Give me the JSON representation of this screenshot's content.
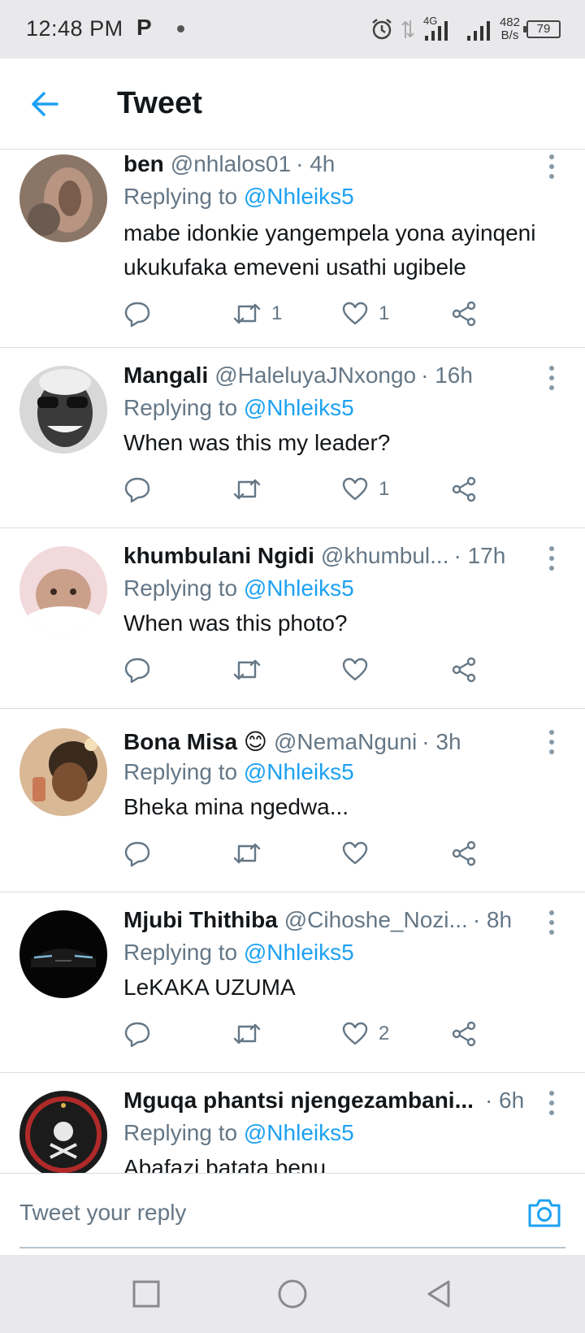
{
  "status_bar": {
    "time": "12:48 PM",
    "carrier_icon": "P",
    "network": "4G",
    "speed_value": "482",
    "speed_unit": "B/s",
    "battery": "79"
  },
  "header": {
    "title": "Tweet"
  },
  "reply_prefix": "Replying to",
  "tweets": [
    {
      "name": "ben",
      "handle": "@nhlalos01",
      "time": "· 4h",
      "replying_to": "@Nhleiks5",
      "text": "mabe idonkie yangempela yona ayinqeni ukukufaka emeveni usathi ugibele",
      "retweets": "1",
      "likes": "1"
    },
    {
      "name": "Mangali",
      "handle": "@HaleluyaJNxongo",
      "time": "· 16h",
      "replying_to": "@Nhleiks5",
      "text": "When was this my leader?",
      "retweets": "",
      "likes": "1"
    },
    {
      "name": "khumbulani Ngidi",
      "handle": "@khumbul...",
      "time": "· 17h",
      "replying_to": "@Nhleiks5",
      "text": "When was this photo?",
      "retweets": "",
      "likes": ""
    },
    {
      "name": "Bona Misa 😊",
      "handle": "@NemaNguni",
      "time": "· 3h",
      "replying_to": "@Nhleiks5",
      "text": "Bheka mina ngedwa...",
      "retweets": "",
      "likes": ""
    },
    {
      "name": "Mjubi Thithiba",
      "handle": "@Cihoshe_Nozi...",
      "time": "· 8h",
      "replying_to": "@Nhleiks5",
      "text": "LeKAKA UZUMA",
      "retweets": "",
      "likes": "2"
    },
    {
      "name": "Mguqa phantsi njengezambani...",
      "handle": "",
      "time": "· 6h",
      "replying_to": "@Nhleiks5",
      "text": "Abafazi batata benu",
      "retweets": "",
      "likes": ""
    }
  ],
  "composer": {
    "placeholder": "Tweet your reply"
  },
  "colors": {
    "accent": "#1da1f2",
    "secondary_text": "#657786",
    "divider": "#d8dde1"
  }
}
